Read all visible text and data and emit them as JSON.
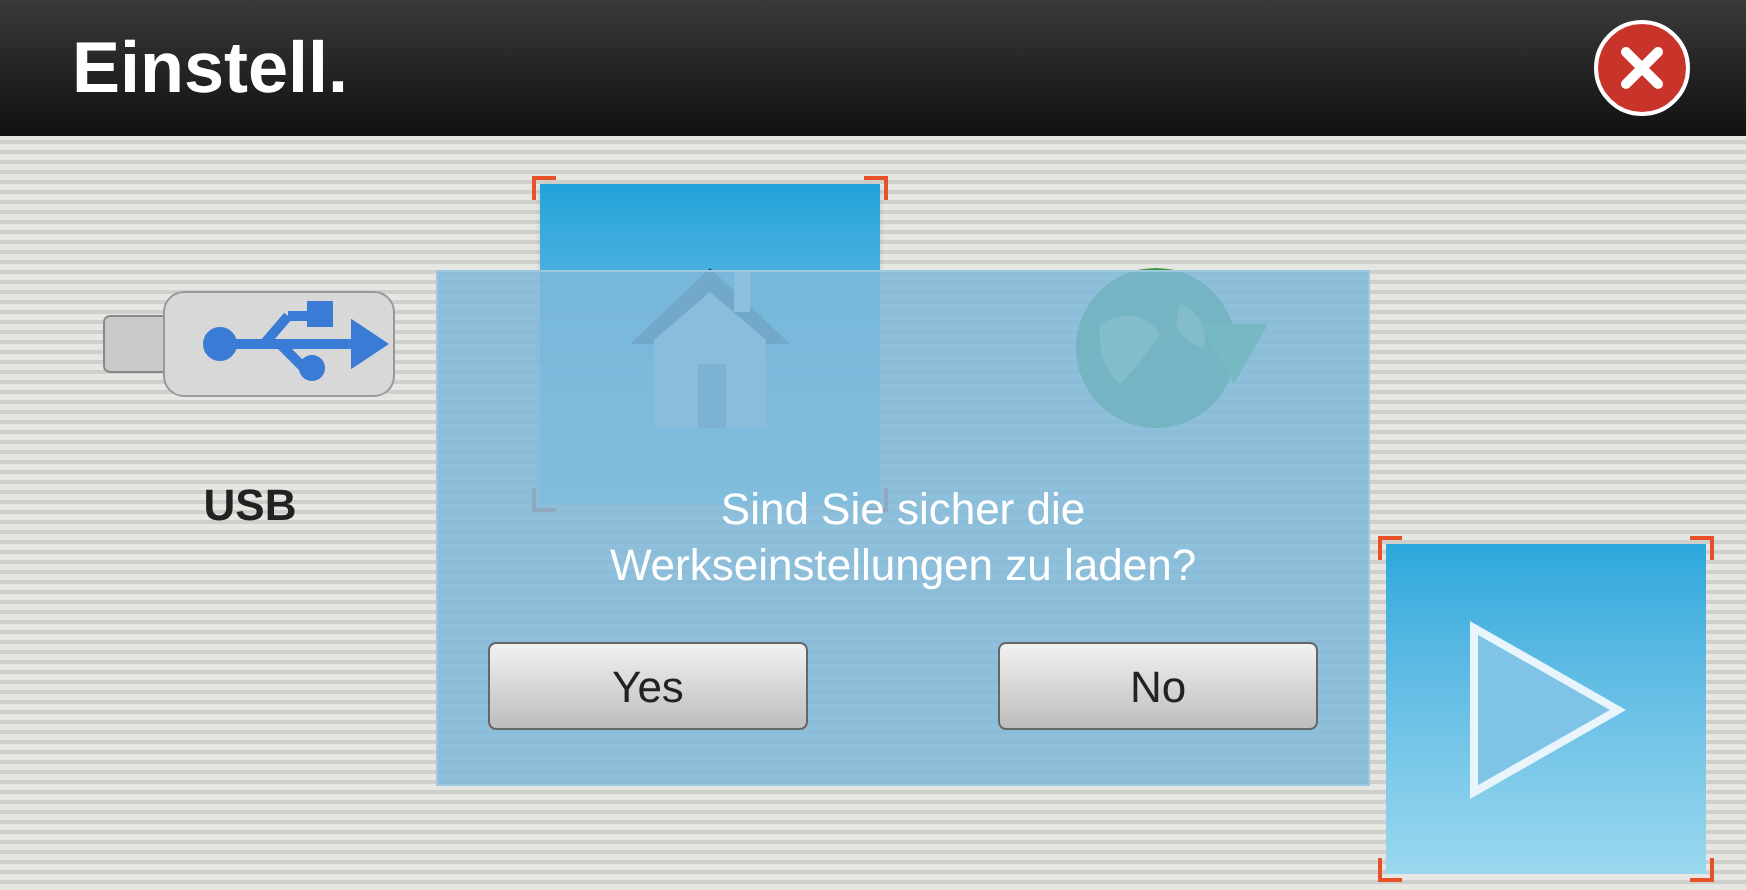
{
  "window": {
    "title": "Einstell."
  },
  "items": [
    {
      "kind": "usb",
      "label": "USB",
      "selected": false
    },
    {
      "kind": "home",
      "selected": true
    },
    {
      "kind": "globe",
      "selected": false
    }
  ],
  "next_button": {
    "selected": true
  },
  "dialog": {
    "message_lines": [
      "Sind Sie sicher die",
      "Werkseinstellungen zu laden?"
    ],
    "buttons": [
      "Yes",
      "No"
    ]
  }
}
